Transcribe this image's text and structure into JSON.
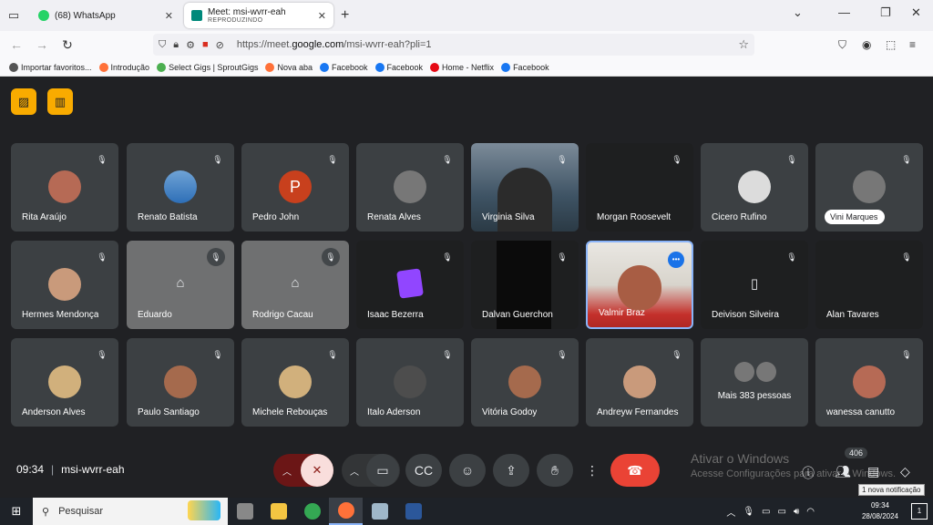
{
  "browser": {
    "tabs": [
      {
        "title": "(68) WhatsApp",
        "subtitle": "",
        "active": false,
        "favicon_color": "#25d366"
      },
      {
        "title": "Meet: msi-wvrr-eah",
        "subtitle": "REPRODUZINDO",
        "active": true,
        "favicon_color": "#00897b"
      }
    ],
    "new_tab": "+",
    "url_prefix": "https://meet.",
    "url_domain": "google.com",
    "url_path": "/msi-wvrr-eah?pli=1",
    "bookmarks": [
      {
        "label": "Importar favoritos...",
        "icon": "import-icon",
        "color": "#555"
      },
      {
        "label": "Introdução",
        "icon": "firefox-icon",
        "color": "#ff7139"
      },
      {
        "label": "Select Gigs | SproutGigs",
        "icon": "leaf-icon",
        "color": "#4caf50"
      },
      {
        "label": "Nova aba",
        "icon": "firefox-icon",
        "color": "#ff7139"
      },
      {
        "label": "Facebook",
        "icon": "facebook-icon",
        "color": "#1877f2"
      },
      {
        "label": "Facebook",
        "icon": "facebook-icon",
        "color": "#1877f2"
      },
      {
        "label": "Home - Netflix",
        "icon": "netflix-icon",
        "color": "#e50914"
      },
      {
        "label": "Facebook",
        "icon": "facebook-icon",
        "color": "#1877f2"
      }
    ]
  },
  "meet": {
    "participants": [
      {
        "name": "Rita Araújo",
        "kind": "avatar",
        "style": "c5"
      },
      {
        "name": "Renato Batista",
        "kind": "avatar",
        "style": "sky"
      },
      {
        "name": "Pedro John",
        "kind": "letter",
        "letter": "P"
      },
      {
        "name": "Renata Alves",
        "kind": "avatar",
        "style": "c2"
      },
      {
        "name": "Virginia Silva",
        "kind": "video-vs"
      },
      {
        "name": "Morgan Roosevelt",
        "kind": "dark"
      },
      {
        "name": "Cicero Rufino",
        "kind": "avatar",
        "style": "c4"
      },
      {
        "name": "Vini Marques",
        "kind": "nametag",
        "style": "c2"
      },
      {
        "name": "Hermes Mendonça",
        "kind": "avatar",
        "style": "c7"
      },
      {
        "name": "Eduardo",
        "kind": "grey"
      },
      {
        "name": "Rodrigo Cacau",
        "kind": "grey"
      },
      {
        "name": "Isaac Bezerra",
        "kind": "twitch"
      },
      {
        "name": "Dalvan Guerchon",
        "kind": "stripe"
      },
      {
        "name": "Valmir Braz",
        "kind": "video-vb"
      },
      {
        "name": "Deivison Silveira",
        "kind": "dark-icon"
      },
      {
        "name": "Alan Tavares",
        "kind": "dark"
      },
      {
        "name": "Anderson Alves",
        "kind": "avatar",
        "style": "c3"
      },
      {
        "name": "Paulo Santiago",
        "kind": "avatar",
        "style": "c1"
      },
      {
        "name": "Michele Rebouças",
        "kind": "avatar",
        "style": "c3"
      },
      {
        "name": "Ítalo Aderson",
        "kind": "avatar",
        "style": "c6"
      },
      {
        "name": "Vitória Godoy",
        "kind": "avatar",
        "style": "c1"
      },
      {
        "name": "Andreyw Fernandes",
        "kind": "avatar",
        "style": "c7"
      },
      {
        "name": "Mais 383 pessoas",
        "kind": "more"
      },
      {
        "name": "wanessa canutto",
        "kind": "avatar",
        "style": "c5"
      }
    ],
    "time": "09:34",
    "meeting_code": "msi-wvrr-eah",
    "people_count": "406",
    "activate_title": "Ativar o Windows",
    "activate_sub": "Acesse Configurações para ativar o Windows.",
    "notification_tooltip": "1 nova notificação"
  },
  "taskbar": {
    "search_placeholder": "Pesquisar",
    "clock_time": "09:34",
    "clock_date": "28/08/2024",
    "apps": [
      {
        "name": "task-view",
        "color": "#888"
      },
      {
        "name": "file-explorer",
        "color": "#f4c542"
      },
      {
        "name": "chrome",
        "color": "#34a853"
      },
      {
        "name": "firefox",
        "color": "#ff7139"
      },
      {
        "name": "app-5",
        "color": "#9fb7c9"
      },
      {
        "name": "word",
        "color": "#2b579a"
      }
    ]
  },
  "colors": {
    "meet_bg": "#202124",
    "tile_bg": "#3c4043",
    "end_call": "#ea4335",
    "accent_yellow": "#f9ab00"
  }
}
